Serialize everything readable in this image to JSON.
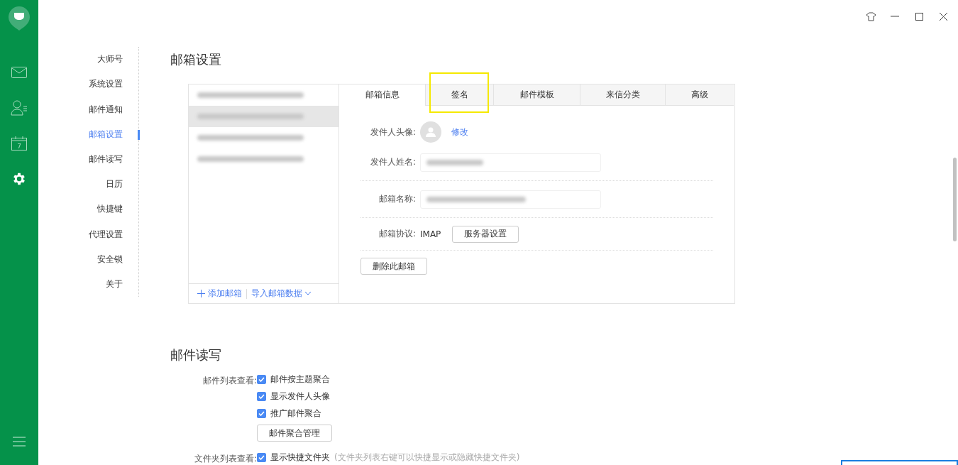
{
  "nav": [
    {
      "label": "大师号",
      "selected": false
    },
    {
      "label": "系统设置",
      "selected": false
    },
    {
      "label": "邮件通知",
      "selected": false
    },
    {
      "label": "邮箱设置",
      "selected": true
    },
    {
      "label": "邮件读写",
      "selected": false
    },
    {
      "label": "日历",
      "selected": false
    },
    {
      "label": "快捷键",
      "selected": false
    },
    {
      "label": "代理设置",
      "selected": false
    },
    {
      "label": "安全锁",
      "selected": false
    },
    {
      "label": "关于",
      "selected": false
    }
  ],
  "rail": {
    "items": [
      {
        "kind": "mail",
        "selected": false
      },
      {
        "kind": "contacts",
        "selected": false
      },
      {
        "kind": "calendar",
        "selected": false,
        "day": "7"
      },
      {
        "kind": "settings",
        "selected": true
      }
    ]
  },
  "mailbox": {
    "title": "邮箱设置",
    "accounts": [
      {
        "selected": false
      },
      {
        "selected": true
      },
      {
        "selected": false
      },
      {
        "selected": false
      }
    ],
    "add": "添加邮箱",
    "import": "导入邮箱数据",
    "tabs": [
      {
        "label": "邮箱信息",
        "selected": true,
        "highlighted": false
      },
      {
        "label": "签名",
        "selected": false,
        "highlighted": true
      },
      {
        "label": "邮件模板",
        "selected": false,
        "highlighted": false
      },
      {
        "label": "来信分类",
        "selected": false,
        "highlighted": false
      },
      {
        "label": "高级",
        "selected": false,
        "highlighted": false
      }
    ],
    "avatar_label": "发件人头像:",
    "avatar_edit": "修改",
    "name_label": "发件人姓名:",
    "mailbox_name_label": "邮箱名称:",
    "protocol_label": "邮箱协议:",
    "protocol": "IMAP",
    "server_button": "服务器设置",
    "delete_button": "删除此邮箱"
  },
  "reading": {
    "title": "邮件读写",
    "groups": [
      {
        "label": "邮件列表查看:",
        "options": [
          {
            "label": "邮件按主题聚合",
            "checked": true
          },
          {
            "label": "显示发件人头像",
            "checked": true
          },
          {
            "label": "推广邮件聚合",
            "checked": true
          }
        ],
        "button": "邮件聚合管理"
      },
      {
        "label": "文件夹列表查看:",
        "options": [
          {
            "label": "显示快捷文件夹",
            "checked": true,
            "hint": "(文件夹列表右键可以快捷显示或隐藏快捷文件夹)"
          }
        ]
      }
    ]
  }
}
